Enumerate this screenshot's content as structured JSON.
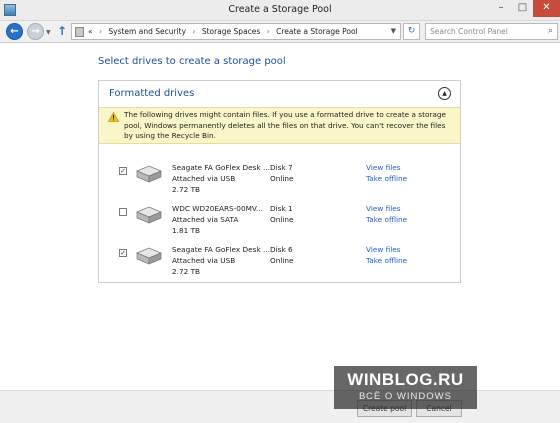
{
  "window": {
    "title": "Create a Storage Pool",
    "min_glyph": "–",
    "max_glyph": "□",
    "close_glyph": "✕"
  },
  "navbar": {
    "back_glyph": "←",
    "forward_glyph": "→",
    "up_glyph": "↑",
    "breadcrumbs": [
      "«",
      "System and Security",
      "Storage Spaces",
      "Create a Storage Pool"
    ],
    "refresh_glyph": "↻",
    "search_placeholder": "Search Control Panel"
  },
  "main": {
    "heading": "Select drives to create a storage pool",
    "panel": {
      "title": "Formatted drives",
      "collapse_glyph": "▲",
      "warning": "The following drives might contain files. If you use a formatted drive to create a storage pool, Windows permanently deletes all the files on that drive. You can't recover the files by using the Recycle Bin."
    },
    "drives": [
      {
        "name": "Seagate FA GoFlex Desk ...",
        "connection": "Attached via USB",
        "size": "2.72 TB",
        "disk": "Disk 7",
        "status": "Online",
        "view_files": "View files",
        "take_offline": "Take offline",
        "checked": true
      },
      {
        "name": "WDC WD20EARS-00MV...",
        "connection": "Attached via SATA",
        "size": "1.81 TB",
        "disk": "Disk 1",
        "status": "Online",
        "view_files": "View files",
        "take_offline": "Take offline",
        "checked": false
      },
      {
        "name": "Seagate FA GoFlex Desk ...",
        "connection": "Attached via USB",
        "size": "2.72 TB",
        "disk": "Disk 6",
        "status": "Online",
        "view_files": "View files",
        "take_offline": "Take offline",
        "checked": true
      }
    ]
  },
  "footer": {
    "create_label": "Create pool",
    "cancel_label": "Cancel"
  },
  "watermark": {
    "title": "WINBLOG.RU",
    "subtitle": "ВСЁ О WINDOWS"
  },
  "colors": {
    "accent": "#1e4f9a",
    "link": "#1f5fbf",
    "warning_bg": "#fbf6c8"
  }
}
